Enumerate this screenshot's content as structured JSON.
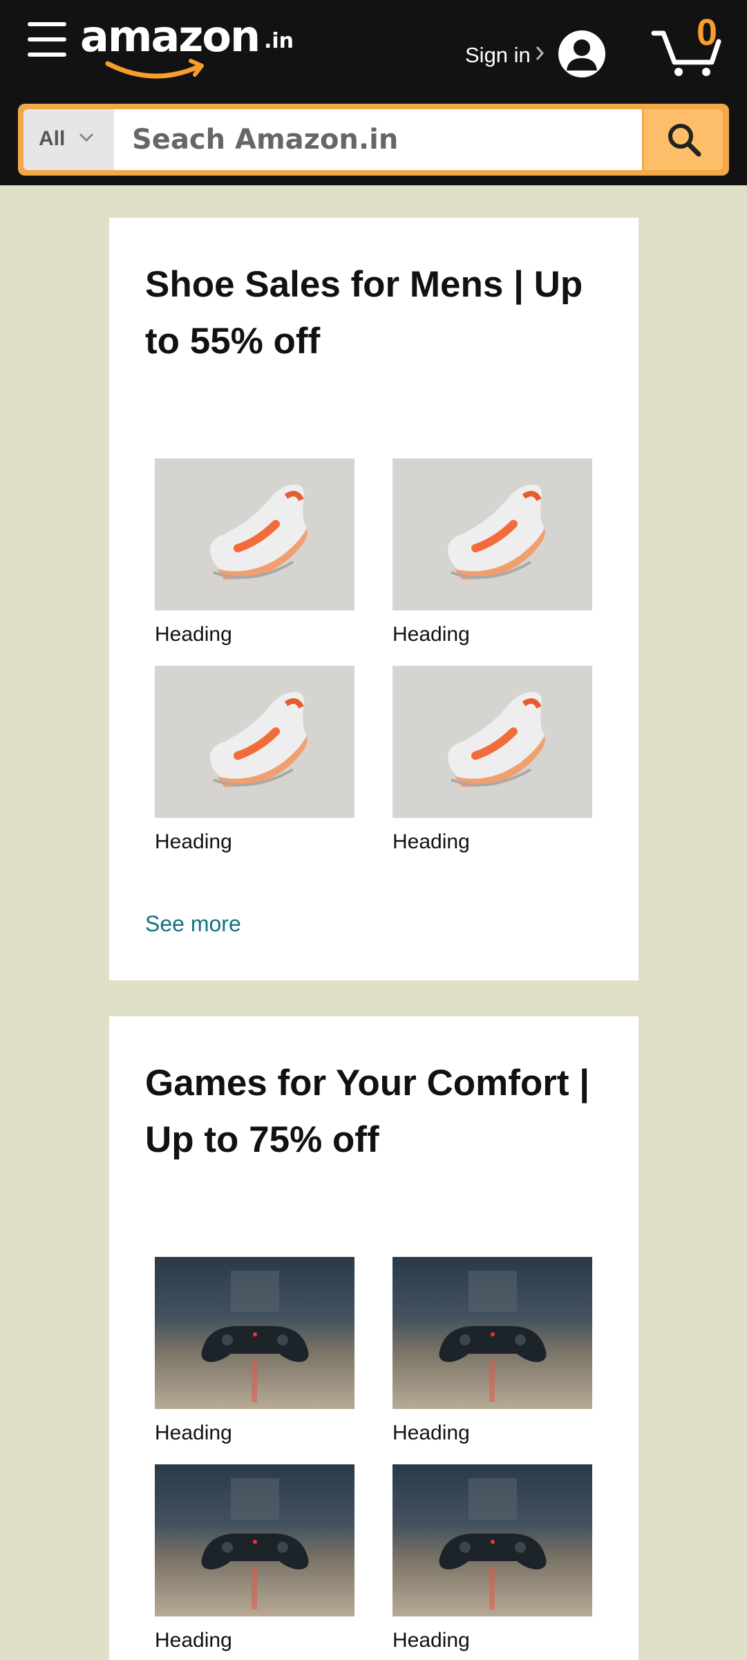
{
  "header": {
    "logo_text": "amazon",
    "logo_tld": ".in",
    "signin_label": "Sign in",
    "cart_count": "0",
    "search": {
      "category": "All",
      "placeholder": "Seach Amazon.in"
    },
    "colors": {
      "bar": "#121212",
      "accent": "#f3a847",
      "cart_count": "#f79d2d"
    },
    "icons": [
      "hamburger-menu-icon",
      "chevron-right-icon",
      "user-avatar-icon",
      "cart-icon",
      "chevron-down-icon",
      "search-icon"
    ]
  },
  "cards": [
    {
      "title": "Shoe Sales for Mens | Up to 55% off",
      "products": [
        {
          "label": "Heading",
          "image": "sneaker-photo"
        },
        {
          "label": "Heading",
          "image": "sneaker-photo"
        },
        {
          "label": "Heading",
          "image": "sneaker-photo"
        },
        {
          "label": "Heading",
          "image": "sneaker-photo"
        }
      ],
      "see_more": "See more"
    },
    {
      "title": "Games for Your Comfort | Up to 75% off",
      "products": [
        {
          "label": "Heading",
          "image": "game-controller-photo"
        },
        {
          "label": "Heading",
          "image": "game-controller-photo"
        },
        {
          "label": "Heading",
          "image": "game-controller-photo"
        },
        {
          "label": "Heading",
          "image": "game-controller-photo"
        }
      ]
    }
  ]
}
